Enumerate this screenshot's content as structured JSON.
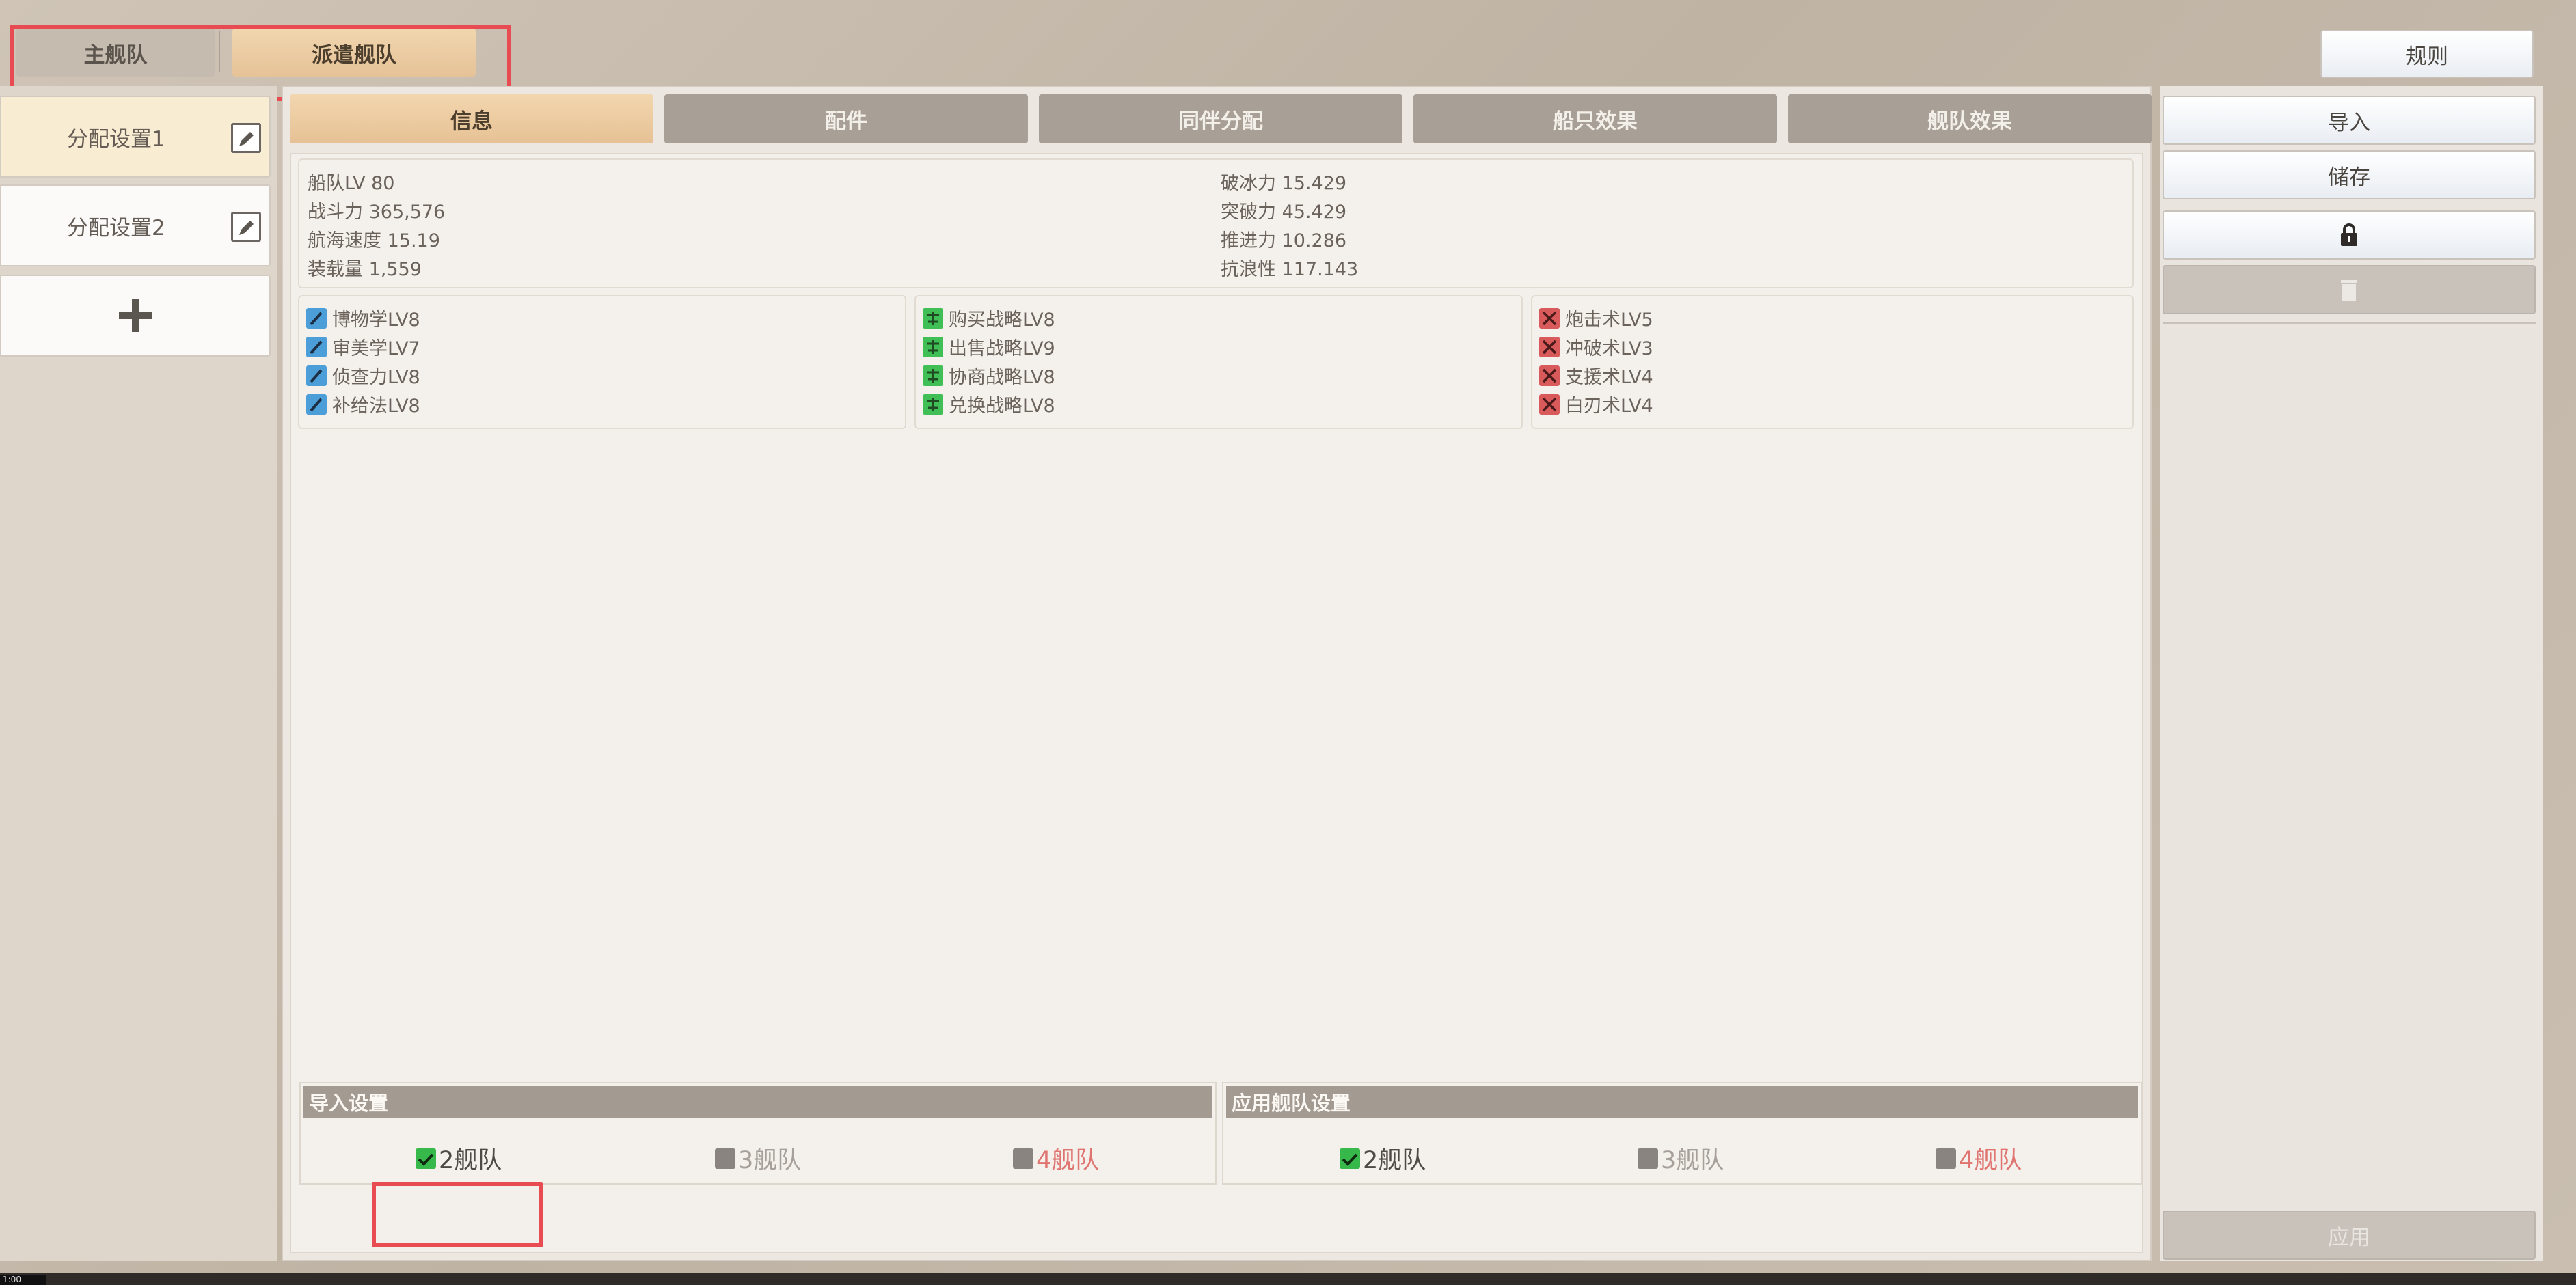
{
  "fleet_tabs": {
    "main": "主舰队",
    "dispatch": "派遣舰队"
  },
  "rules_label": "规则",
  "presets": [
    {
      "label": "分配设置1",
      "selected": true
    },
    {
      "label": "分配设置2",
      "selected": false
    }
  ],
  "sub_tabs": [
    "信息",
    "配件",
    "同伴分配",
    "船只效果",
    "舰队效果"
  ],
  "stats": {
    "left": [
      "船队LV 80",
      "战斗力 365,576",
      "航海速度 15.19",
      "装载量 1,559"
    ],
    "right": [
      "破冰力 15.429",
      "突破力 45.429",
      "推进力 10.286",
      "抗浪性 117.143"
    ]
  },
  "skills": {
    "study": [
      "博物学LV8",
      "审美学LV7",
      "侦查力LV8",
      "补给法LV8"
    ],
    "trade": [
      "购买战略LV8",
      "出售战略LV9",
      "协商战略LV8",
      "兑换战略LV8"
    ],
    "battle": [
      "炮击术LV5",
      "冲破术LV3",
      "支援术LV4",
      "白刃术LV4"
    ]
  },
  "import_settings": {
    "title": "导入设置",
    "options": [
      {
        "label": "2舰队",
        "checked": true,
        "warn": false
      },
      {
        "label": "3舰队",
        "checked": false,
        "warn": false
      },
      {
        "label": "4舰队",
        "checked": false,
        "warn": true
      }
    ]
  },
  "apply_settings": {
    "title": "应用舰队设置",
    "options": [
      {
        "label": "2舰队",
        "checked": true,
        "warn": false
      },
      {
        "label": "3舰队",
        "checked": false,
        "warn": false
      },
      {
        "label": "4舰队",
        "checked": false,
        "warn": true
      }
    ]
  },
  "right_buttons": {
    "import": "导入",
    "save": "储存",
    "apply": "应用"
  },
  "icons": {
    "edit": "edit-icon",
    "add": "plus-icon",
    "lock": "lock-icon",
    "delete": "trash-icon",
    "study_skill": "pencil-icon",
    "trade_skill": "trade-icon",
    "battle_skill": "crossed-swords-icon"
  },
  "colors": {
    "accent": "#e7c195",
    "highlight": "#e84c52",
    "check_on": "#36b94a",
    "warn_text": "#e07470"
  },
  "clock": "1:00"
}
